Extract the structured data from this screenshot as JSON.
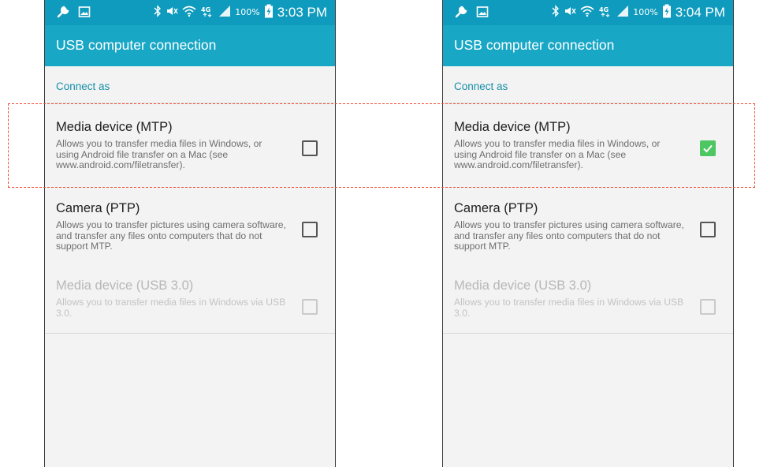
{
  "screens": [
    {
      "status_bar": {
        "battery_text": "100%",
        "time": "3:03 PM",
        "icons": [
          "wrench-icon",
          "image-icon",
          "bluetooth-icon",
          "mute-icon",
          "wifi-icon",
          "network-4g-icon",
          "signal-icon",
          "battery-charging-icon"
        ]
      },
      "app_bar": {
        "title": "USB computer connection"
      },
      "section": {
        "header": "Connect as"
      },
      "options": [
        {
          "title": "Media device (MTP)",
          "description": "Allows you to transfer media files in Windows, or using Android file transfer on a Mac (see www.android.com/filetransfer).",
          "checked": false,
          "enabled": true
        },
        {
          "title": "Camera (PTP)",
          "description": "Allows you to transfer pictures using camera software, and transfer any files onto computers that do not support MTP.",
          "checked": false,
          "enabled": true
        },
        {
          "title": "Media device (USB 3.0)",
          "description": "Allows you to transfer media files in Windows via USB 3.0.",
          "checked": false,
          "enabled": false
        }
      ]
    },
    {
      "status_bar": {
        "battery_text": "100%",
        "time": "3:04 PM",
        "icons": [
          "wrench-icon",
          "image-icon",
          "bluetooth-icon",
          "mute-icon",
          "wifi-icon",
          "network-4g-icon",
          "signal-icon",
          "battery-charging-icon"
        ]
      },
      "app_bar": {
        "title": "USB computer connection"
      },
      "section": {
        "header": "Connect as"
      },
      "options": [
        {
          "title": "Media device (MTP)",
          "description": "Allows you to transfer media files in Windows, or using Android file transfer on a Mac (see www.android.com/filetransfer).",
          "checked": true,
          "enabled": true
        },
        {
          "title": "Camera (PTP)",
          "description": "Allows you to transfer pictures using camera software, and transfer any files onto computers that do not support MTP.",
          "checked": false,
          "enabled": true
        },
        {
          "title": "Media device (USB 3.0)",
          "description": "Allows you to transfer media files in Windows via USB 3.0.",
          "checked": false,
          "enabled": false
        }
      ]
    }
  ],
  "colors": {
    "status_bar": "#0f9bbd",
    "app_bar": "#19a7c6",
    "accent_text": "#168fa8",
    "checked": "#4ec763",
    "highlight": "#f14e31"
  }
}
